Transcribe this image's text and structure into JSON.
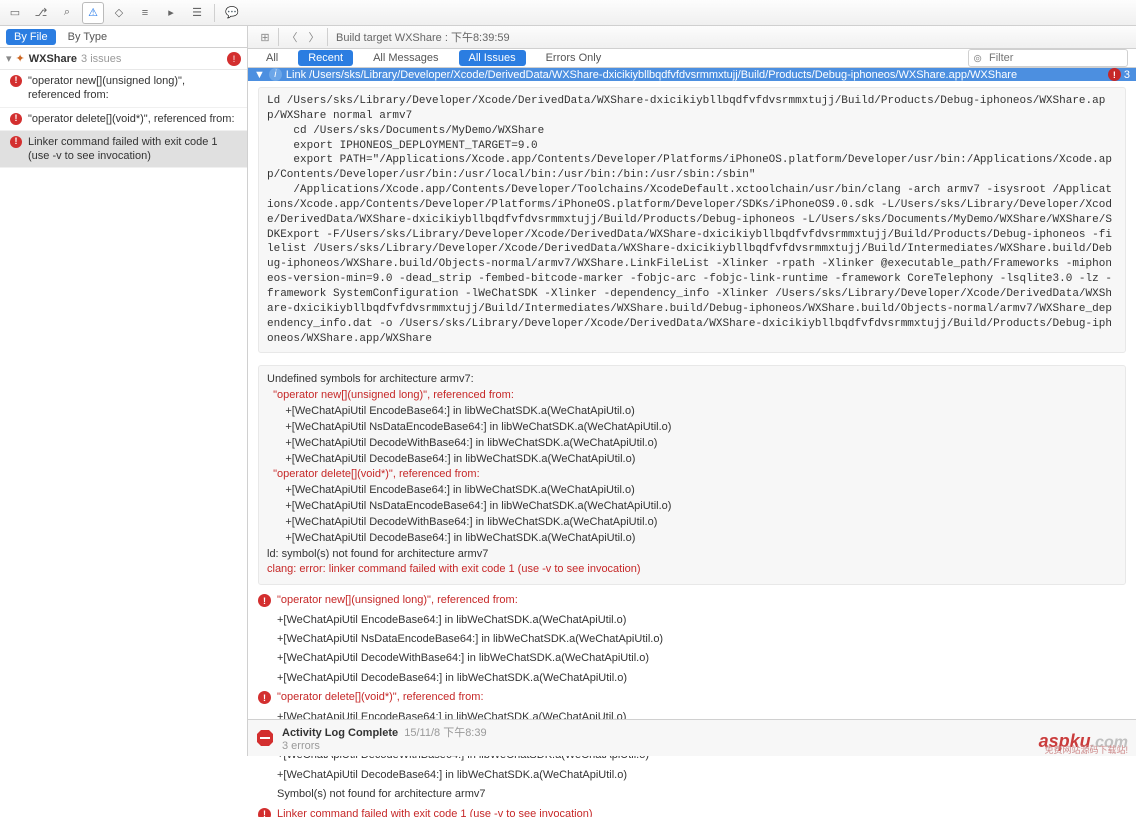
{
  "toolbar": {
    "breadcrumb": "Build target WXShare : 下午8:39:59"
  },
  "sidebar": {
    "by_file": "By File",
    "by_type": "By Type",
    "project": "WXShare",
    "issues_count": "3 issues",
    "items": [
      {
        "text": "\"operator new[](unsigned long)\", referenced from:"
      },
      {
        "text": "\"operator delete[](void*)\", referenced from:"
      },
      {
        "text": "Linker command failed with exit code 1 (use -v to see invocation)"
      }
    ]
  },
  "issue_tabs": {
    "all": "All",
    "recent": "Recent",
    "all_messages": "All Messages",
    "all_issues": "All Issues",
    "errors_only": "Errors Only",
    "filter_placeholder": "Filter"
  },
  "blue_bar": {
    "text": "Link /Users/sks/Library/Developer/Xcode/DerivedData/WXShare-dxicikiybllbqdfvfdvsrmmxtujj/Build/Products/Debug-iphoneos/WXShare.app/WXShare",
    "count": "3"
  },
  "build_log": "Ld /Users/sks/Library/Developer/Xcode/DerivedData/WXShare-dxicikiybllbqdfvfdvsrmmxtujj/Build/Products/Debug-iphoneos/WXShare.app/WXShare normal armv7\n    cd /Users/sks/Documents/MyDemo/WXShare\n    export IPHONEOS_DEPLOYMENT_TARGET=9.0\n    export PATH=\"/Applications/Xcode.app/Contents/Developer/Platforms/iPhoneOS.platform/Developer/usr/bin:/Applications/Xcode.app/Contents/Developer/usr/bin:/usr/local/bin:/usr/bin:/bin:/usr/sbin:/sbin\"\n    /Applications/Xcode.app/Contents/Developer/Toolchains/XcodeDefault.xctoolchain/usr/bin/clang -arch armv7 -isysroot /Applications/Xcode.app/Contents/Developer/Platforms/iPhoneOS.platform/Developer/SDKs/iPhoneOS9.0.sdk -L/Users/sks/Library/Developer/Xcode/DerivedData/WXShare-dxicikiybllbqdfvfdvsrmmxtujj/Build/Products/Debug-iphoneos -L/Users/sks/Documents/MyDemo/WXShare/WXShare/SDKExport -F/Users/sks/Library/Developer/Xcode/DerivedData/WXShare-dxicikiybllbqdfvfdvsrmmxtujj/Build/Products/Debug-iphoneos -filelist /Users/sks/Library/Developer/Xcode/DerivedData/WXShare-dxicikiybllbqdfvfdvsrmmxtujj/Build/Intermediates/WXShare.build/Debug-iphoneos/WXShare.build/Objects-normal/armv7/WXShare.LinkFileList -Xlinker -rpath -Xlinker @executable_path/Frameworks -miphoneos-version-min=9.0 -dead_strip -fembed-bitcode-marker -fobjc-arc -fobjc-link-runtime -framework CoreTelephony -lsqlite3.0 -lz -framework SystemConfiguration -lWeChatSDK -Xlinker -dependency_info -Xlinker /Users/sks/Library/Developer/Xcode/DerivedData/WXShare-dxicikiybllbqdfvfdvsrmmxtujj/Build/Intermediates/WXShare.build/Debug-iphoneos/WXShare.build/Objects-normal/armv7/WXShare_dependency_info.dat -o /Users/sks/Library/Developer/Xcode/DerivedData/WXShare-dxicikiybllbqdfvfdvsrmmxtujj/Build/Products/Debug-iphoneos/WXShare.app/WXShare",
  "error_log": {
    "line1": "Undefined symbols for architecture armv7:",
    "sym1": "  \"operator new[](unsigned long)\", referenced from:",
    "refs1": "      +[WeChatApiUtil EncodeBase64:] in libWeChatSDK.a(WeChatApiUtil.o)\n      +[WeChatApiUtil NsDataEncodeBase64:] in libWeChatSDK.a(WeChatApiUtil.o)\n      +[WeChatApiUtil DecodeWithBase64:] in libWeChatSDK.a(WeChatApiUtil.o)\n      +[WeChatApiUtil DecodeBase64:] in libWeChatSDK.a(WeChatApiUtil.o)",
    "sym2": "  \"operator delete[](void*)\", referenced from:",
    "refs2": "      +[WeChatApiUtil EncodeBase64:] in libWeChatSDK.a(WeChatApiUtil.o)\n      +[WeChatApiUtil NsDataEncodeBase64:] in libWeChatSDK.a(WeChatApiUtil.o)\n      +[WeChatApiUtil DecodeWithBase64:] in libWeChatSDK.a(WeChatApiUtil.o)\n      +[WeChatApiUtil DecodeBase64:] in libWeChatSDK.a(WeChatApiUtil.o)",
    "ld": "ld: symbol(s) not found for architecture armv7",
    "clang_prefix": "clang: error:",
    "clang_msg": " linker command failed with exit code 1 (use -v to see invocation)"
  },
  "details": [
    {
      "icon": true,
      "red": true,
      "text": "\"operator new[](unsigned long)\", referenced from:"
    },
    {
      "icon": false,
      "text": "+[WeChatApiUtil EncodeBase64:] in libWeChatSDK.a(WeChatApiUtil.o)"
    },
    {
      "icon": false,
      "text": "+[WeChatApiUtil NsDataEncodeBase64:] in libWeChatSDK.a(WeChatApiUtil.o)"
    },
    {
      "icon": false,
      "text": "+[WeChatApiUtil DecodeWithBase64:] in libWeChatSDK.a(WeChatApiUtil.o)"
    },
    {
      "icon": false,
      "text": "+[WeChatApiUtil DecodeBase64:] in libWeChatSDK.a(WeChatApiUtil.o)"
    },
    {
      "icon": true,
      "red": true,
      "text": "\"operator delete[](void*)\", referenced from:"
    },
    {
      "icon": false,
      "text": "+[WeChatApiUtil EncodeBase64:] in libWeChatSDK.a(WeChatApiUtil.o)"
    },
    {
      "icon": false,
      "text": "+[WeChatApiUtil NsDataEncodeBase64:] in libWeChatSDK.a(WeChatApiUtil.o)"
    },
    {
      "icon": false,
      "text": "+[WeChatApiUtil DecodeWithBase64:] in libWeChatSDK.a(WeChatApiUtil.o)"
    },
    {
      "icon": false,
      "text": "+[WeChatApiUtil DecodeBase64:] in libWeChatSDK.a(WeChatApiUtil.o)"
    },
    {
      "icon": false,
      "text": "Symbol(s) not found for architecture armv7"
    },
    {
      "icon": true,
      "red": true,
      "text": "Linker command failed with exit code 1 (use -v to see invocation)"
    }
  ],
  "activity": {
    "title": "Activity Log Complete",
    "time": "15/11/8 下午8:39",
    "errors": "3 errors"
  },
  "watermark": {
    "brand": "aspku",
    "suffix": ".com",
    "sub": "免费网站源码下载站!"
  }
}
